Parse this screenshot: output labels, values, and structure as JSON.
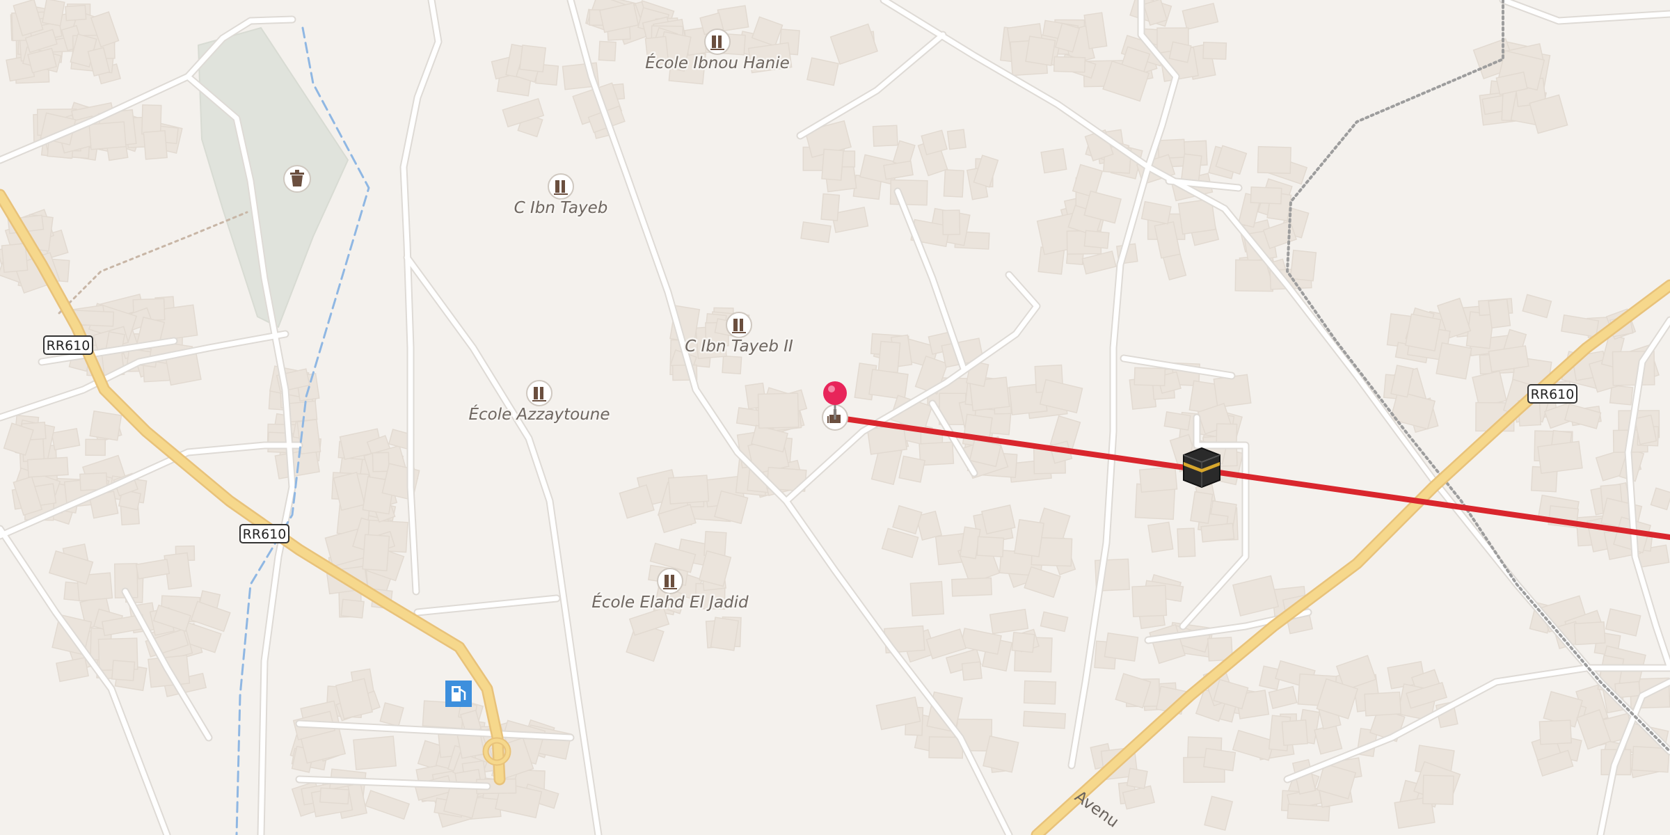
{
  "map": {
    "colors": {
      "background": "#f4f1ed",
      "building": "#ebe4dc",
      "road_minor": "#ffffff",
      "road_casing": "#dedad5",
      "road_primary": "#f6d88c",
      "park": "#e0e3dc",
      "stream": "#8fb7e3",
      "route_line": "#d9262d",
      "pin": "#e8255a",
      "fuel": "#3d8fdd"
    },
    "schools": [
      {
        "name": "École Ibnou Hanie",
        "icon": "school-icon"
      },
      {
        "name": "C Ibn Tayeb",
        "icon": "school-icon"
      },
      {
        "name": "C Ibn Tayeb II",
        "icon": "school-icon"
      },
      {
        "name": "École Azzaytoune",
        "icon": "school-icon"
      },
      {
        "name": "École Elahd El Jadid",
        "icon": "school-icon"
      }
    ],
    "route_shields": [
      {
        "label": "RR610"
      },
      {
        "label": "RR610"
      },
      {
        "label": "RR610"
      }
    ],
    "street_label": "Avenu",
    "markers": {
      "pin": "location-pin-icon",
      "mosque": "mosque-icon",
      "kaaba": "kaaba-icon",
      "fuel": "fuel-station-icon",
      "cemetery": "cemetery-icon"
    }
  }
}
